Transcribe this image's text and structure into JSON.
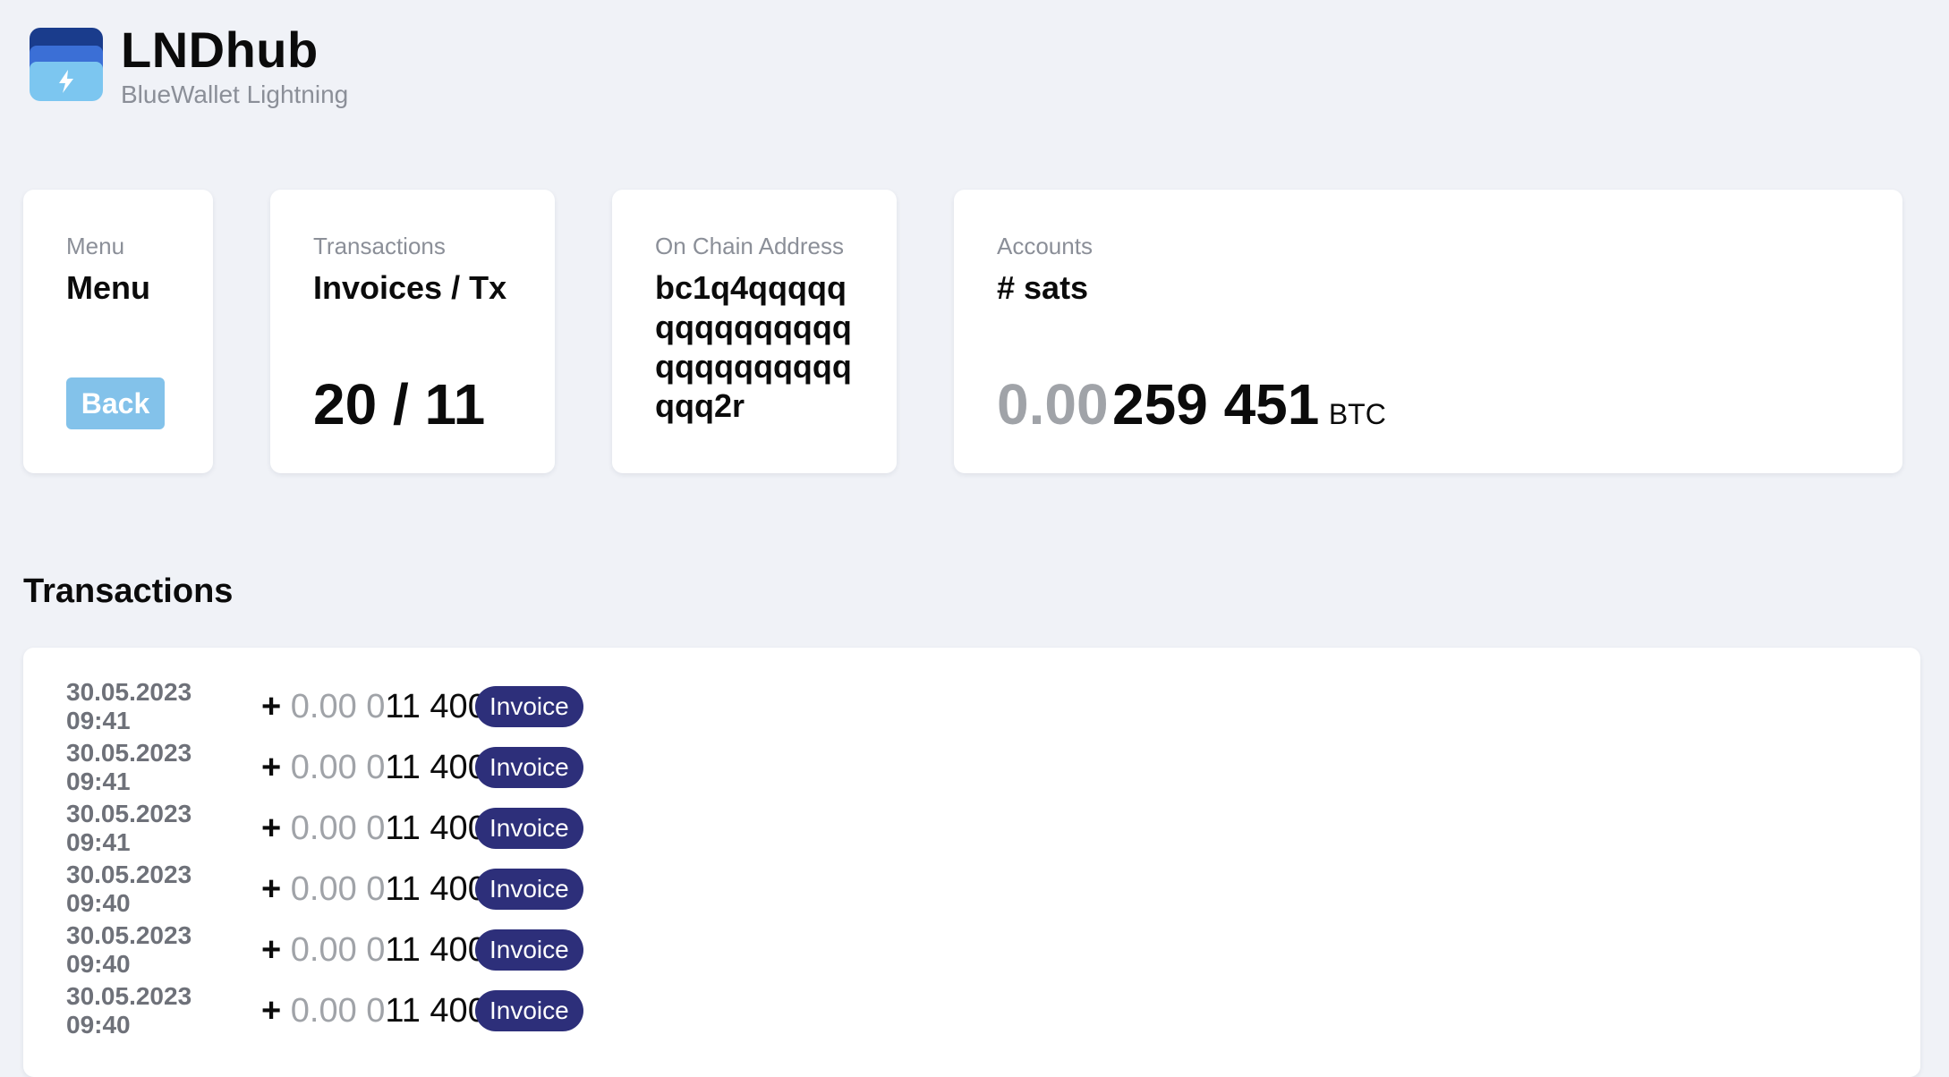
{
  "brand": {
    "title": "LNDhub",
    "subtitle": "BlueWallet Lightning",
    "logo_icon": "lightning-wallet-icon"
  },
  "cards": {
    "menu": {
      "label": "Menu",
      "title": "Menu",
      "button": "Back"
    },
    "transactions": {
      "label": "Transactions",
      "title": "Invoices / Tx",
      "count": "20 / 11"
    },
    "onchain": {
      "label": "On Chain Address",
      "address": "bc1q4qqqqqqqqqqqqqqqqqqqqqqqqqqqq2r"
    },
    "accounts": {
      "label": "Accounts",
      "title": "# sats",
      "balance_dim": "0.00",
      "balance_main": "259 451",
      "unit": "BTC"
    }
  },
  "section_title": "Transactions",
  "transactions": [
    {
      "date": "30.05.2023 09:41",
      "sign": "+",
      "amount_dim": "0.00 0",
      "amount_main": "11 400",
      "type": "Invoice"
    },
    {
      "date": "30.05.2023 09:41",
      "sign": "+",
      "amount_dim": "0.00 0",
      "amount_main": "11 400",
      "type": "Invoice"
    },
    {
      "date": "30.05.2023 09:41",
      "sign": "+",
      "amount_dim": "0.00 0",
      "amount_main": "11 400",
      "type": "Invoice"
    },
    {
      "date": "30.05.2023 09:40",
      "sign": "+",
      "amount_dim": "0.00 0",
      "amount_main": "11 400",
      "type": "Invoice"
    },
    {
      "date": "30.05.2023 09:40",
      "sign": "+",
      "amount_dim": "0.00 0",
      "amount_main": "11 400",
      "type": "Invoice"
    },
    {
      "date": "30.05.2023 09:40",
      "sign": "+",
      "amount_dim": "0.00 0",
      "amount_main": "11 400",
      "type": "Invoice"
    }
  ],
  "colors": {
    "background": "#f0f2f7",
    "back_button": "#83c2ea",
    "badge": "#2d2f7a",
    "dim_text": "#a0a3a8",
    "label_text": "#8b8f98"
  }
}
